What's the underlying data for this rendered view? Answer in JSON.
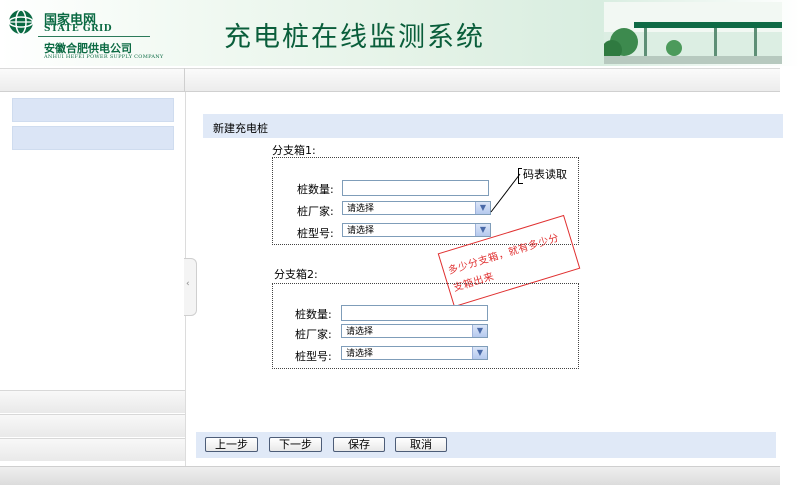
{
  "header": {
    "logo_cn": "国家电网",
    "logo_en": "STATE GRID",
    "company_cn": "安徽合肥供电公司",
    "company_en": "ANHUI HEFEI POWER SUPPLY COMPANY",
    "system_title": "充电桩在线监测系统"
  },
  "main": {
    "section_title": "新建充电桩",
    "groups": [
      {
        "label": "分支箱1:",
        "count_label": "桩数量:",
        "count_value": "",
        "maker_label": "桩厂家:",
        "maker_select": "请选择",
        "model_label": "桩型号:",
        "model_select": "请选择"
      },
      {
        "label": "分支箱2:",
        "count_label": "桩数量:",
        "count_value": "",
        "maker_label": "桩厂家:",
        "maker_select": "请选择",
        "model_label": "桩型号:",
        "model_select": "请选择"
      }
    ],
    "annotation_callout": "码表读取",
    "annotation_stamp_line1": "多少分支箱，就有多少分",
    "annotation_stamp_line2": "支箱出来"
  },
  "buttons": {
    "prev": "上一步",
    "next": "下一步",
    "save": "保存",
    "cancel": "取消"
  },
  "colors": {
    "brand_green": "#0a5e3b",
    "panel_blue": "#e0e9f7",
    "stamp_red": "#e03030"
  }
}
